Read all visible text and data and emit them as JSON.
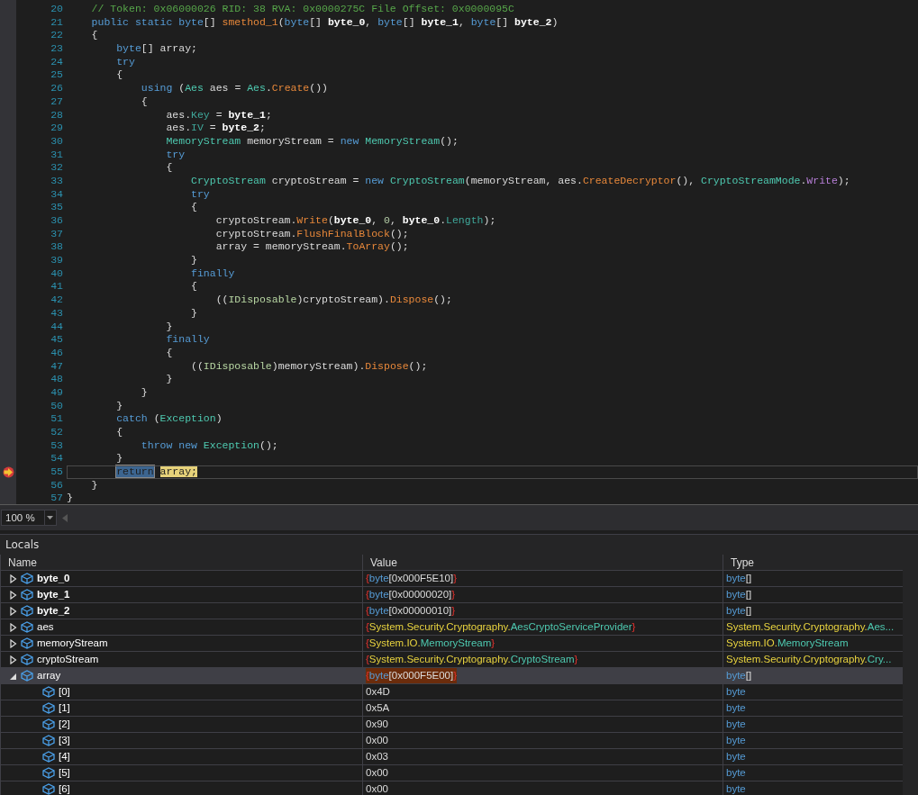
{
  "editor": {
    "lines": [
      {
        "number": "20",
        "current": false,
        "tokens": [
          {
            "kind": "comment",
            "text": "    // Token: 0x06000026 RID: 38 RVA: 0x0000275C File Offset: 0x0000095C"
          }
        ]
      },
      {
        "number": "21",
        "current": false,
        "tokens": [
          {
            "kind": "keyword",
            "text": "    public static byte"
          },
          {
            "kind": "plain",
            "text": "[] "
          },
          {
            "kind": "method",
            "text": "smethod_1"
          },
          {
            "kind": "plain",
            "text": "("
          },
          {
            "kind": "keyword",
            "text": "byte"
          },
          {
            "kind": "plain",
            "text": "[] "
          },
          {
            "kind": "param",
            "text": "byte_0"
          },
          {
            "kind": "plain",
            "text": ", "
          },
          {
            "kind": "keyword",
            "text": "byte"
          },
          {
            "kind": "plain",
            "text": "[] "
          },
          {
            "kind": "param",
            "text": "byte_1"
          },
          {
            "kind": "plain",
            "text": ", "
          },
          {
            "kind": "keyword",
            "text": "byte"
          },
          {
            "kind": "plain",
            "text": "[] "
          },
          {
            "kind": "param",
            "text": "byte_2"
          },
          {
            "kind": "plain",
            "text": ")"
          }
        ]
      },
      {
        "number": "22",
        "current": false,
        "tokens": [
          {
            "kind": "plain",
            "text": "    {"
          }
        ]
      },
      {
        "number": "23",
        "current": false,
        "tokens": [
          {
            "kind": "keyword",
            "text": "        byte"
          },
          {
            "kind": "plain",
            "text": "[] array;"
          }
        ]
      },
      {
        "number": "24",
        "current": false,
        "tokens": [
          {
            "kind": "keyword",
            "text": "        try"
          }
        ]
      },
      {
        "number": "25",
        "current": false,
        "tokens": [
          {
            "kind": "plain",
            "text": "        {"
          }
        ]
      },
      {
        "number": "26",
        "current": false,
        "tokens": [
          {
            "kind": "keyword",
            "text": "            using"
          },
          {
            "kind": "plain",
            "text": " ("
          },
          {
            "kind": "type",
            "text": "Aes"
          },
          {
            "kind": "plain",
            "text": " aes = "
          },
          {
            "kind": "type",
            "text": "Aes"
          },
          {
            "kind": "plain",
            "text": "."
          },
          {
            "kind": "method",
            "text": "Create"
          },
          {
            "kind": "plain",
            "text": "())"
          }
        ]
      },
      {
        "number": "27",
        "current": false,
        "tokens": [
          {
            "kind": "plain",
            "text": "            {"
          }
        ]
      },
      {
        "number": "28",
        "current": false,
        "tokens": [
          {
            "kind": "plain",
            "text": "                aes."
          },
          {
            "kind": "property",
            "text": "Key"
          },
          {
            "kind": "plain",
            "text": " = "
          },
          {
            "kind": "param",
            "text": "byte_1"
          },
          {
            "kind": "plain",
            "text": ";"
          }
        ]
      },
      {
        "number": "29",
        "current": false,
        "tokens": [
          {
            "kind": "plain",
            "text": "                aes."
          },
          {
            "kind": "property",
            "text": "IV"
          },
          {
            "kind": "plain",
            "text": " = "
          },
          {
            "kind": "param",
            "text": "byte_2"
          },
          {
            "kind": "plain",
            "text": ";"
          }
        ]
      },
      {
        "number": "30",
        "current": false,
        "tokens": [
          {
            "kind": "type",
            "text": "                MemoryStream"
          },
          {
            "kind": "plain",
            "text": " memoryStream = "
          },
          {
            "kind": "keyword",
            "text": "new"
          },
          {
            "kind": "type",
            "text": " MemoryStream"
          },
          {
            "kind": "plain",
            "text": "();"
          }
        ]
      },
      {
        "number": "31",
        "current": false,
        "tokens": [
          {
            "kind": "keyword",
            "text": "                try"
          }
        ]
      },
      {
        "number": "32",
        "current": false,
        "tokens": [
          {
            "kind": "plain",
            "text": "                {"
          }
        ]
      },
      {
        "number": "33",
        "current": false,
        "tokens": [
          {
            "kind": "type",
            "text": "                    CryptoStream"
          },
          {
            "kind": "plain",
            "text": " cryptoStream = "
          },
          {
            "kind": "keyword",
            "text": "new"
          },
          {
            "kind": "type",
            "text": " CryptoStream"
          },
          {
            "kind": "plain",
            "text": "(memoryStream, aes."
          },
          {
            "kind": "method",
            "text": "CreateDecryptor"
          },
          {
            "kind": "plain",
            "text": "(), "
          },
          {
            "kind": "type",
            "text": "CryptoStreamMode"
          },
          {
            "kind": "plain",
            "text": "."
          },
          {
            "kind": "enum",
            "text": "Write"
          },
          {
            "kind": "plain",
            "text": ");"
          }
        ]
      },
      {
        "number": "34",
        "current": false,
        "tokens": [
          {
            "kind": "keyword",
            "text": "                    try"
          }
        ]
      },
      {
        "number": "35",
        "current": false,
        "tokens": [
          {
            "kind": "plain",
            "text": "                    {"
          }
        ]
      },
      {
        "number": "36",
        "current": false,
        "tokens": [
          {
            "kind": "plain",
            "text": "                        cryptoStream."
          },
          {
            "kind": "method",
            "text": "Write"
          },
          {
            "kind": "plain",
            "text": "("
          },
          {
            "kind": "param",
            "text": "byte_0"
          },
          {
            "kind": "plain",
            "text": ", "
          },
          {
            "kind": "number",
            "text": "0"
          },
          {
            "kind": "plain",
            "text": ", "
          },
          {
            "kind": "param",
            "text": "byte_0"
          },
          {
            "kind": "plain",
            "text": "."
          },
          {
            "kind": "property",
            "text": "Length"
          },
          {
            "kind": "plain",
            "text": ");"
          }
        ]
      },
      {
        "number": "37",
        "current": false,
        "tokens": [
          {
            "kind": "plain",
            "text": "                        cryptoStream."
          },
          {
            "kind": "method",
            "text": "FlushFinalBlock"
          },
          {
            "kind": "plain",
            "text": "();"
          }
        ]
      },
      {
        "number": "38",
        "current": false,
        "tokens": [
          {
            "kind": "plain",
            "text": "                        array = memoryStream."
          },
          {
            "kind": "method",
            "text": "ToArray"
          },
          {
            "kind": "plain",
            "text": "();"
          }
        ]
      },
      {
        "number": "39",
        "current": false,
        "tokens": [
          {
            "kind": "plain",
            "text": "                    }"
          }
        ]
      },
      {
        "number": "40",
        "current": false,
        "tokens": [
          {
            "kind": "keyword",
            "text": "                    finally"
          }
        ]
      },
      {
        "number": "41",
        "current": false,
        "tokens": [
          {
            "kind": "plain",
            "text": "                    {"
          }
        ]
      },
      {
        "number": "42",
        "current": false,
        "tokens": [
          {
            "kind": "plain",
            "text": "                        (("
          },
          {
            "kind": "interface",
            "text": "IDisposable"
          },
          {
            "kind": "plain",
            "text": ")cryptoStream)."
          },
          {
            "kind": "method",
            "text": "Dispose"
          },
          {
            "kind": "plain",
            "text": "();"
          }
        ]
      },
      {
        "number": "43",
        "current": false,
        "tokens": [
          {
            "kind": "plain",
            "text": "                    }"
          }
        ]
      },
      {
        "number": "44",
        "current": false,
        "tokens": [
          {
            "kind": "plain",
            "text": "                }"
          }
        ]
      },
      {
        "number": "45",
        "current": false,
        "tokens": [
          {
            "kind": "keyword",
            "text": "                finally"
          }
        ]
      },
      {
        "number": "46",
        "current": false,
        "tokens": [
          {
            "kind": "plain",
            "text": "                {"
          }
        ]
      },
      {
        "number": "47",
        "current": false,
        "tokens": [
          {
            "kind": "plain",
            "text": "                    (("
          },
          {
            "kind": "interface",
            "text": "IDisposable"
          },
          {
            "kind": "plain",
            "text": ")memoryStream)."
          },
          {
            "kind": "method",
            "text": "Dispose"
          },
          {
            "kind": "plain",
            "text": "();"
          }
        ]
      },
      {
        "number": "48",
        "current": false,
        "tokens": [
          {
            "kind": "plain",
            "text": "                }"
          }
        ]
      },
      {
        "number": "49",
        "current": false,
        "tokens": [
          {
            "kind": "plain",
            "text": "            }"
          }
        ]
      },
      {
        "number": "50",
        "current": false,
        "tokens": [
          {
            "kind": "plain",
            "text": "        }"
          }
        ]
      },
      {
        "number": "51",
        "current": false,
        "tokens": [
          {
            "kind": "keyword",
            "text": "        catch"
          },
          {
            "kind": "plain",
            "text": " ("
          },
          {
            "kind": "type",
            "text": "Exception"
          },
          {
            "kind": "plain",
            "text": ")"
          }
        ]
      },
      {
        "number": "52",
        "current": false,
        "tokens": [
          {
            "kind": "plain",
            "text": "        {"
          }
        ]
      },
      {
        "number": "53",
        "current": false,
        "tokens": [
          {
            "kind": "keyword",
            "text": "            throw new"
          },
          {
            "kind": "type",
            "text": " Exception"
          },
          {
            "kind": "plain",
            "text": "();"
          }
        ]
      },
      {
        "number": "54",
        "current": false,
        "tokens": [
          {
            "kind": "plain",
            "text": "        }"
          }
        ]
      },
      {
        "number": "55",
        "current": true,
        "tokens": [
          {
            "kind": "selection",
            "text": "        return"
          },
          {
            "kind": "statement",
            "text": " array;"
          }
        ]
      },
      {
        "number": "56",
        "current": false,
        "tokens": [
          {
            "kind": "plain",
            "text": "    }"
          }
        ]
      },
      {
        "number": "57",
        "current": false,
        "tokens": [
          {
            "kind": "plain",
            "text": "}"
          }
        ]
      }
    ]
  },
  "zoom": {
    "value": "100 %"
  },
  "locals": {
    "title": "Locals",
    "columns": [
      "Name",
      "Value",
      "Type"
    ],
    "rows": [
      {
        "name": "byte_0",
        "bold": true,
        "expanded": false,
        "selected": false,
        "changed": false,
        "value": [
          {
            "kind": "brace",
            "text": "{"
          },
          {
            "kind": "keyword",
            "text": "byte"
          },
          {
            "kind": "plain",
            "text": "[0x000F5E10]"
          },
          {
            "kind": "brace",
            "text": "}"
          }
        ],
        "type": [
          {
            "kind": "keyword",
            "text": "byte"
          },
          {
            "kind": "plain",
            "text": "[]"
          }
        ]
      },
      {
        "name": "byte_1",
        "bold": true,
        "expanded": false,
        "selected": false,
        "changed": false,
        "value": [
          {
            "kind": "brace",
            "text": "{"
          },
          {
            "kind": "keyword",
            "text": "byte"
          },
          {
            "kind": "plain",
            "text": "[0x00000020]"
          },
          {
            "kind": "brace",
            "text": "}"
          }
        ],
        "type": [
          {
            "kind": "keyword",
            "text": "byte"
          },
          {
            "kind": "plain",
            "text": "[]"
          }
        ]
      },
      {
        "name": "byte_2",
        "bold": true,
        "expanded": false,
        "selected": false,
        "changed": false,
        "value": [
          {
            "kind": "brace",
            "text": "{"
          },
          {
            "kind": "keyword",
            "text": "byte"
          },
          {
            "kind": "plain",
            "text": "[0x00000010]"
          },
          {
            "kind": "brace",
            "text": "}"
          }
        ],
        "type": [
          {
            "kind": "keyword",
            "text": "byte"
          },
          {
            "kind": "plain",
            "text": "[]"
          }
        ]
      },
      {
        "name": "aes",
        "bold": false,
        "expanded": false,
        "selected": false,
        "changed": false,
        "value": [
          {
            "kind": "brace",
            "text": "{"
          },
          {
            "kind": "namespace",
            "text": "System.Security.Cryptography."
          },
          {
            "kind": "type",
            "text": "AesCryptoServiceProvider"
          },
          {
            "kind": "brace",
            "text": "}"
          }
        ],
        "type": [
          {
            "kind": "namespace",
            "text": "System.Security.Cryptography."
          },
          {
            "kind": "type",
            "text": "Aes..."
          }
        ]
      },
      {
        "name": "memoryStream",
        "bold": false,
        "expanded": false,
        "selected": false,
        "changed": false,
        "value": [
          {
            "kind": "brace",
            "text": "{"
          },
          {
            "kind": "namespace",
            "text": "System.IO."
          },
          {
            "kind": "type",
            "text": "MemoryStream"
          },
          {
            "kind": "brace",
            "text": "}"
          }
        ],
        "type": [
          {
            "kind": "namespace",
            "text": "System.IO."
          },
          {
            "kind": "type",
            "text": "MemoryStream"
          }
        ]
      },
      {
        "name": "cryptoStream",
        "bold": false,
        "expanded": false,
        "selected": false,
        "changed": false,
        "value": [
          {
            "kind": "brace",
            "text": "{"
          },
          {
            "kind": "namespace",
            "text": "System.Security.Cryptography."
          },
          {
            "kind": "type",
            "text": "CryptoStream"
          },
          {
            "kind": "brace",
            "text": "}"
          }
        ],
        "type": [
          {
            "kind": "namespace",
            "text": "System.Security.Cryptography."
          },
          {
            "kind": "type",
            "text": "Cry..."
          }
        ]
      },
      {
        "name": "array",
        "bold": false,
        "expanded": true,
        "selected": true,
        "changed": true,
        "value": [
          {
            "kind": "brace",
            "text": "{"
          },
          {
            "kind": "keyword",
            "text": "byte"
          },
          {
            "kind": "plain",
            "text": "[0x000F5E00]"
          },
          {
            "kind": "brace",
            "text": "}"
          }
        ],
        "type": [
          {
            "kind": "keyword",
            "text": "byte"
          },
          {
            "kind": "plain",
            "text": "[]"
          }
        ],
        "children": [
          {
            "name": "[0]",
            "value": [
              {
                "kind": "plain",
                "text": "0x4D"
              }
            ],
            "type": [
              {
                "kind": "keyword",
                "text": "byte"
              }
            ]
          },
          {
            "name": "[1]",
            "value": [
              {
                "kind": "plain",
                "text": "0x5A"
              }
            ],
            "type": [
              {
                "kind": "keyword",
                "text": "byte"
              }
            ]
          },
          {
            "name": "[2]",
            "value": [
              {
                "kind": "plain",
                "text": "0x90"
              }
            ],
            "type": [
              {
                "kind": "keyword",
                "text": "byte"
              }
            ]
          },
          {
            "name": "[3]",
            "value": [
              {
                "kind": "plain",
                "text": "0x00"
              }
            ],
            "type": [
              {
                "kind": "keyword",
                "text": "byte"
              }
            ]
          },
          {
            "name": "[4]",
            "value": [
              {
                "kind": "plain",
                "text": "0x03"
              }
            ],
            "type": [
              {
                "kind": "keyword",
                "text": "byte"
              }
            ]
          },
          {
            "name": "[5]",
            "value": [
              {
                "kind": "plain",
                "text": "0x00"
              }
            ],
            "type": [
              {
                "kind": "keyword",
                "text": "byte"
              }
            ]
          },
          {
            "name": "[6]",
            "value": [
              {
                "kind": "plain",
                "text": "0x00"
              }
            ],
            "type": [
              {
                "kind": "keyword",
                "text": "byte"
              }
            ]
          }
        ]
      }
    ]
  }
}
